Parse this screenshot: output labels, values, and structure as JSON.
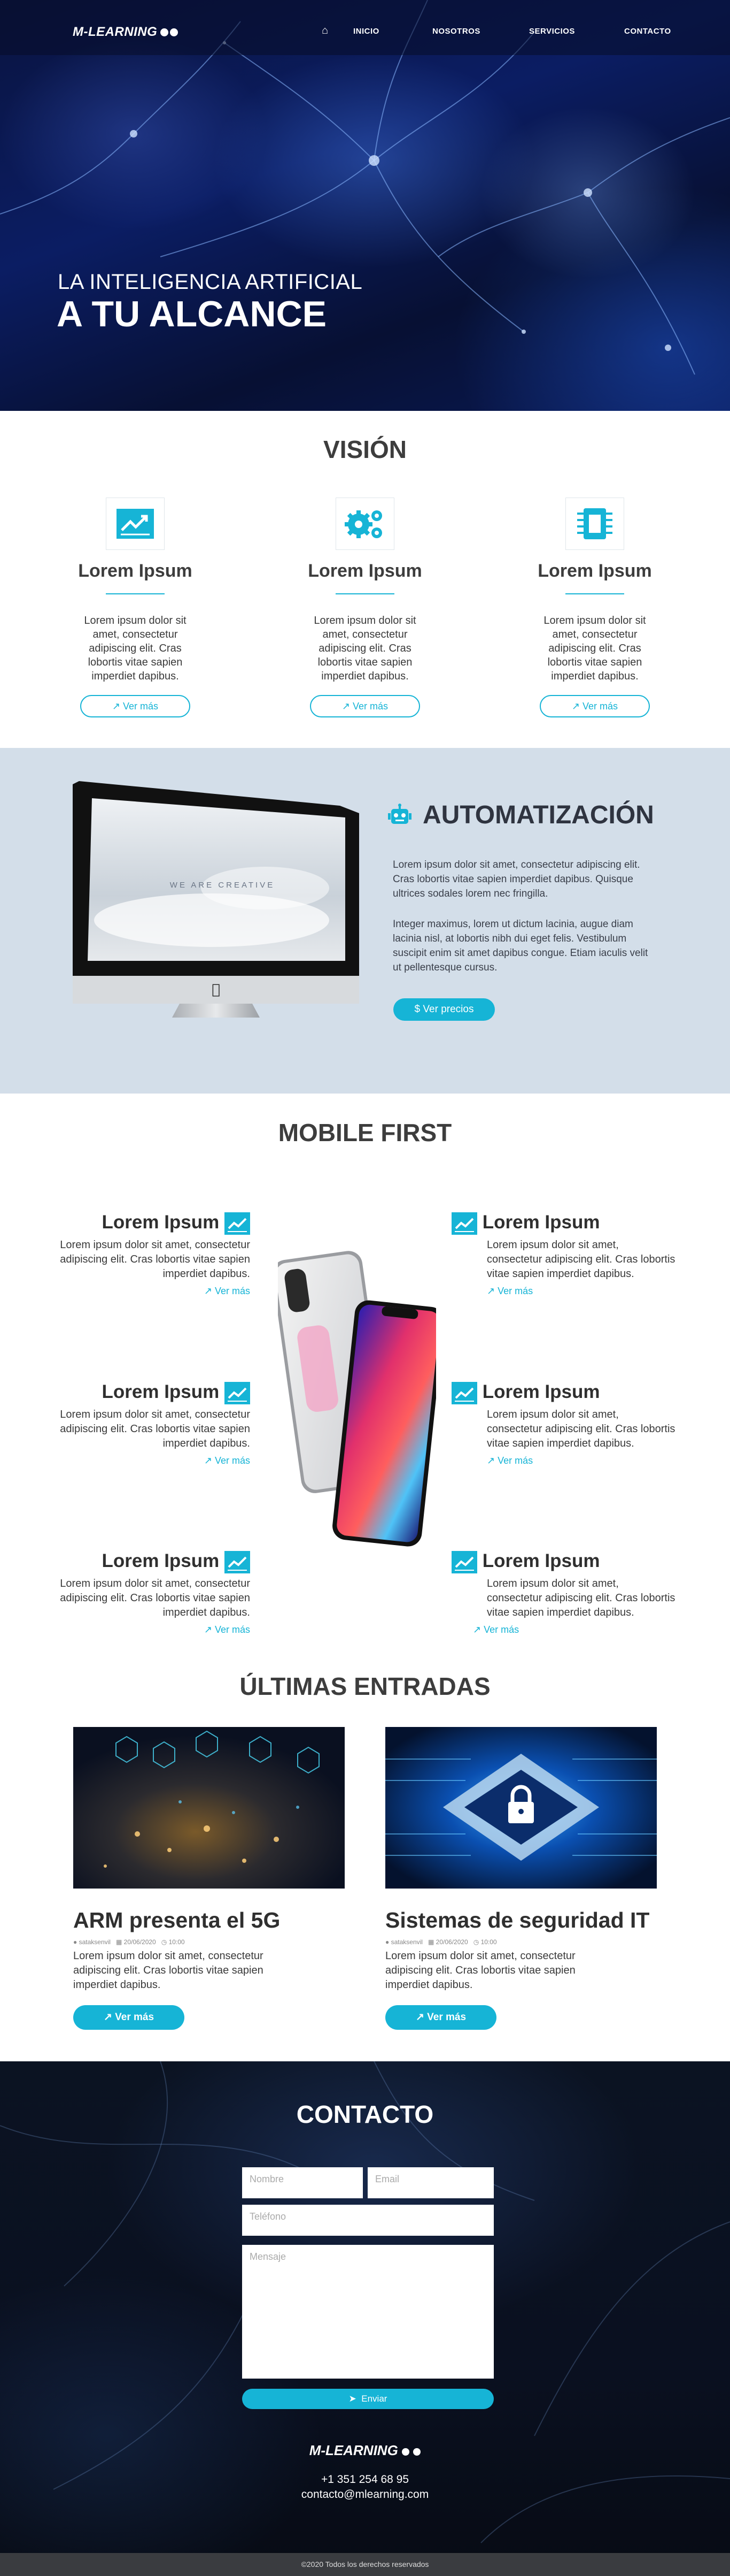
{
  "nav": {
    "logo": "M-LEARNING",
    "items": [
      {
        "label": "INICIO"
      },
      {
        "label": "NOSOTROS"
      },
      {
        "label": "SERVICIOS"
      },
      {
        "label": "CONTACTO"
      }
    ]
  },
  "hero": {
    "line1": "LA INTELIGENCIA ARTIFICIAL",
    "line2": "A TU ALCANCE"
  },
  "vision": {
    "title": "VISIÓN",
    "items": [
      {
        "icon": "chart-icon",
        "title": "Lorem Ipsum",
        "text": "Lorem ipsum dolor sit amet, consectetur adipiscing elit. Cras lobortis vitae sapien imperdiet dapibus.",
        "button": "Ver más"
      },
      {
        "icon": "gears-icon",
        "title": "Lorem Ipsum",
        "text": "Lorem ipsum dolor sit amet, consectetur adipiscing elit. Cras lobortis vitae sapien imperdiet dapibus.",
        "button": "Ver más"
      },
      {
        "icon": "chip-icon",
        "title": "Lorem Ipsum",
        "text": "Lorem ipsum dolor sit amet, consectetur adipiscing elit. Cras lobortis vitae sapien imperdiet dapibus.",
        "button": "Ver más"
      }
    ]
  },
  "automatizacion": {
    "title": "AUTOMATIZACIÓN",
    "p1": "Lorem ipsum dolor sit amet, consectetur adipiscing elit. Cras lobortis vitae sapien imperdiet dapibus. Quisque ultrices sodales lorem nec fringilla.",
    "p2": "Integer maximus, lorem ut dictum lacinia, augue diam lacinia nisl, at lobortis nibh dui eget felis. Vestibulum suscipit enim sit amet dapibus congue. Etiam iaculis velit ut pellentesque cursus.",
    "button": "Ver  precios",
    "screen_text": "WE ARE CREATIVE"
  },
  "mobile": {
    "title": "MOBILE FIRST",
    "features": [
      {
        "title": "Lorem Ipsum",
        "text": "Lorem ipsum dolor sit amet, consectetur adipiscing elit. Cras lobortis vitae sapien imperdiet dapibus.",
        "more": "Ver más"
      },
      {
        "title": "Lorem Ipsum",
        "text": "Lorem ipsum dolor sit amet, consectetur adipiscing elit. Cras lobortis vitae sapien imperdiet dapibus.",
        "more": "Ver más"
      },
      {
        "title": "Lorem Ipsum",
        "text": "Lorem ipsum dolor sit amet, consectetur adipiscing elit. Cras lobortis vitae sapien imperdiet dapibus.",
        "more": "Ver más"
      },
      {
        "title": "Lorem Ipsum",
        "text": "Lorem ipsum dolor sit amet, consectetur adipiscing elit. Cras lobortis vitae sapien imperdiet dapibus.",
        "more": "Ver más"
      },
      {
        "title": "Lorem Ipsum",
        "text": "Lorem ipsum dolor sit amet, consectetur adipiscing elit. Cras lobortis vitae sapien imperdiet dapibus.",
        "more": "Ver más"
      },
      {
        "title": "Lorem Ipsum",
        "text": "Lorem ipsum dolor sit amet, consectetur adipiscing elit. Cras lobortis vitae sapien imperdiet dapibus.",
        "more": "Ver más"
      }
    ]
  },
  "posts": {
    "title": "ÚLTIMAS ENTRADAS",
    "items": [
      {
        "title": "ARM presenta el 5G",
        "author": "sataksenvil",
        "date": "20/06/2020",
        "comments": "10:00",
        "text": "Lorem ipsum dolor sit amet, consectetur adipiscing elit. Cras lobortis vitae sapien imperdiet dapibus.",
        "button": "Ver más"
      },
      {
        "title": "Sistemas de seguridad IT",
        "author": "sataksenvil",
        "date": "20/06/2020",
        "comments": "10:00",
        "text": "Lorem ipsum dolor sit amet, consectetur adipiscing elit. Cras lobortis vitae sapien imperdiet dapibus.",
        "button": "Ver más"
      }
    ]
  },
  "contact": {
    "title": "CONTACTO",
    "name_placeholder": "Nombre",
    "email_placeholder": "Email",
    "phone_placeholder": "Teléfono",
    "message_placeholder": "Mensaje",
    "submit": "Enviar",
    "logo": "M-LEARNING",
    "phone": "+1 351 254 68 95",
    "email": "contacto@mlearning.com"
  },
  "footer": {
    "copyright": "©2020 Todos los derechos reservados"
  },
  "colors": {
    "accent": "#16b4d6",
    "band": "#d3dee9",
    "dark": "#0b1322"
  }
}
